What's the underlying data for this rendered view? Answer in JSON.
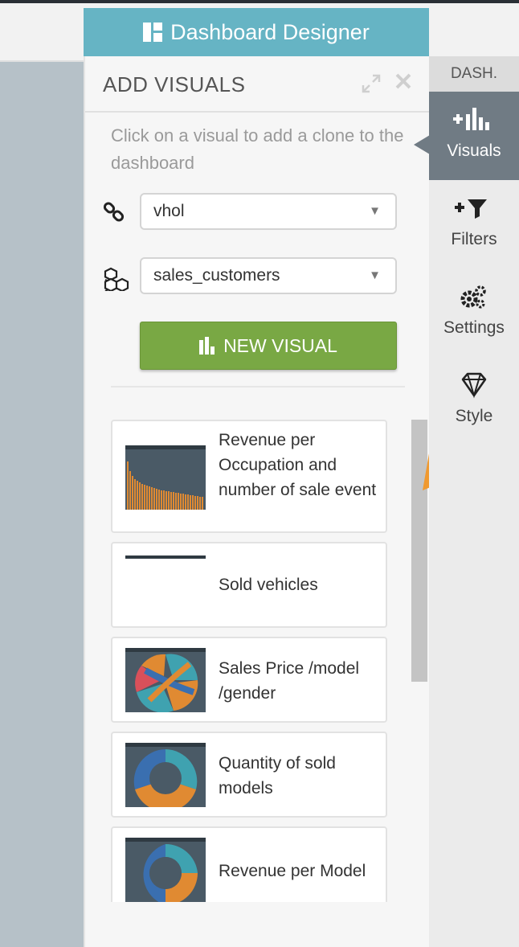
{
  "header": {
    "title": "Dashboard Designer",
    "icon": "layout-blocks-icon"
  },
  "panel": {
    "title": "ADD VISUALS",
    "instruction": "Click on a visual to add a clone to the dashboard",
    "connection": {
      "icon": "link-icon",
      "value": "vhol"
    },
    "dataset": {
      "icon": "cubes-icon",
      "value": "sales_customers"
    },
    "new_visual_label": "NEW VISUAL",
    "visuals": [
      {
        "label": "Revenue per Occupation and number of sale event",
        "thumbnail": "bar-chart-thumbnail"
      },
      {
        "label": "Sold vehicles",
        "thumbnail": "table-thumbnail"
      },
      {
        "label": "Sales Price /model /gender",
        "thumbnail": "chord-chart-thumbnail"
      },
      {
        "label": "Quantity of sold models",
        "thumbnail": "donut-chart-thumbnail"
      },
      {
        "label": "Revenue per Model",
        "thumbnail": "donut-chart-thumbnail"
      }
    ]
  },
  "rail": {
    "dash_label": "DASH.",
    "items": [
      {
        "label": "Visuals",
        "icon": "add-chart-icon",
        "active": true
      },
      {
        "label": "Filters",
        "icon": "add-filter-icon",
        "active": false
      },
      {
        "label": "Settings",
        "icon": "gears-icon",
        "active": false
      },
      {
        "label": "Style",
        "icon": "diamond-icon",
        "active": false
      }
    ]
  },
  "colors": {
    "header_bg": "#66b4c4",
    "button_green": "#79a844",
    "rail_active": "#707b84",
    "arrow_orange": "#f0992f"
  }
}
